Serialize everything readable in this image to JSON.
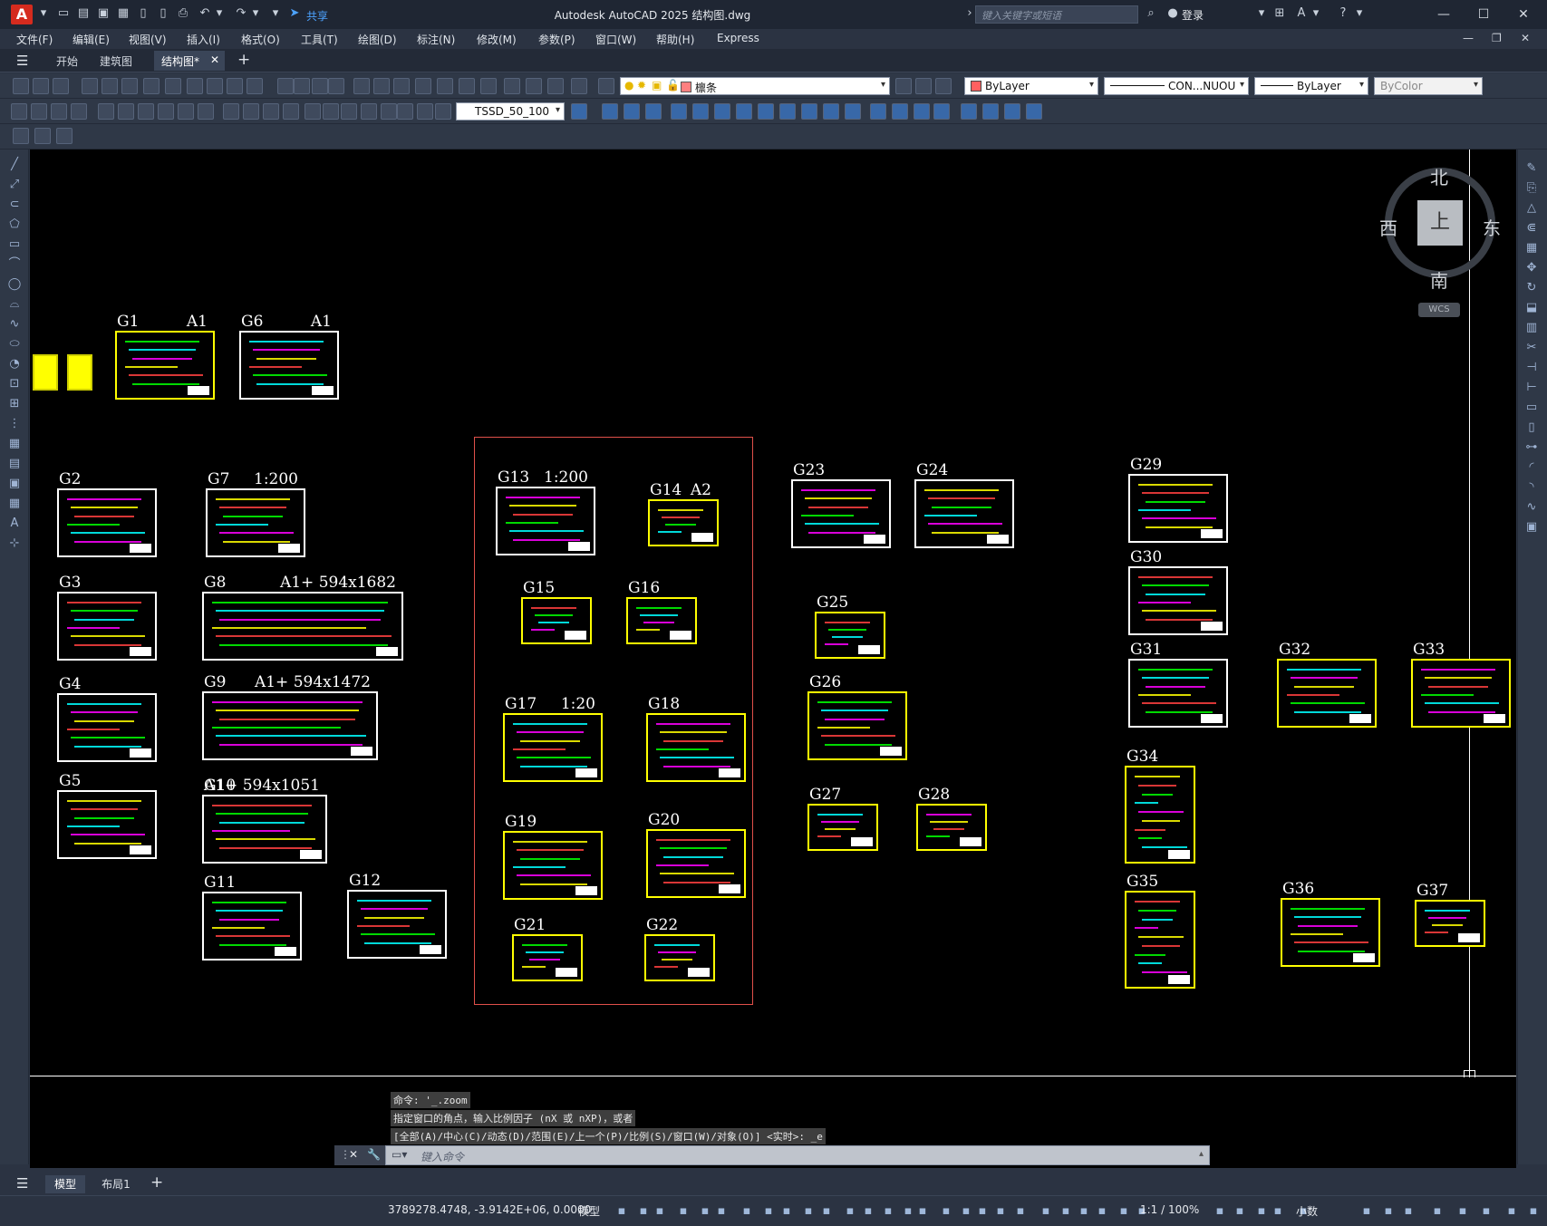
{
  "app": {
    "title": "Autodesk AutoCAD 2025    结构图.dwg",
    "share_label": "共享",
    "search_placeholder": "键入关键字或短语",
    "login_label": "登录"
  },
  "menu": [
    "文件(F)",
    "编辑(E)",
    "视图(V)",
    "插入(I)",
    "格式(O)",
    "工具(T)",
    "绘图(D)",
    "标注(N)",
    "修改(M)",
    "参数(P)",
    "窗口(W)",
    "帮助(H)",
    "Express"
  ],
  "tabs": [
    {
      "label": "开始",
      "active": false
    },
    {
      "label": "建筑图",
      "active": false
    },
    {
      "label": "结构图*",
      "active": true
    }
  ],
  "toolbar": {
    "layer_name": "檩条",
    "color_value": "ByLayer",
    "linetype_value": "CON...NUOU",
    "lineweight_value": "ByLayer",
    "plotstyle_value": "ByColor",
    "dimstyle_value": "TSSD_50_100"
  },
  "viewcube": {
    "north": "北",
    "south": "南",
    "east": "东",
    "west": "西",
    "face": "上",
    "wcs": "WCS"
  },
  "drawing": {
    "sheets": [
      {
        "id": "G1",
        "label": "G1",
        "scale": "A1"
      },
      {
        "id": "G6",
        "label": "G6",
        "scale": "A1"
      },
      {
        "id": "G2",
        "label": "G2",
        "scale": ""
      },
      {
        "id": "G7",
        "label": "G7",
        "scale": "1:200"
      },
      {
        "id": "G3",
        "label": "G3",
        "scale": ""
      },
      {
        "id": "G8",
        "label": "G8",
        "scale": "A1+ 594x1682"
      },
      {
        "id": "G4",
        "label": "G4",
        "scale": ""
      },
      {
        "id": "G9",
        "label": "G9",
        "scale": "A1+ 594x1472"
      },
      {
        "id": "G5",
        "label": "G5",
        "scale": ""
      },
      {
        "id": "G10",
        "label": "G10",
        "scale": "A1+ 594x1051"
      },
      {
        "id": "G11",
        "label": "G11",
        "scale": ""
      },
      {
        "id": "G12",
        "label": "G12",
        "scale": ""
      },
      {
        "id": "G13",
        "label": "G13",
        "scale": "1:200"
      },
      {
        "id": "G14",
        "label": "G14",
        "scale": "A2"
      },
      {
        "id": "G15",
        "label": "G15",
        "scale": ""
      },
      {
        "id": "G16",
        "label": "G16",
        "scale": ""
      },
      {
        "id": "G17",
        "label": "G17",
        "scale": "1:20"
      },
      {
        "id": "G18",
        "label": "G18",
        "scale": ""
      },
      {
        "id": "G19",
        "label": "G19",
        "scale": ""
      },
      {
        "id": "G20",
        "label": "G20",
        "scale": ""
      },
      {
        "id": "G21",
        "label": "G21",
        "scale": ""
      },
      {
        "id": "G22",
        "label": "G22",
        "scale": ""
      },
      {
        "id": "G23",
        "label": "G23",
        "scale": ""
      },
      {
        "id": "G24",
        "label": "G24",
        "scale": ""
      },
      {
        "id": "G25",
        "label": "G25",
        "scale": ""
      },
      {
        "id": "G26",
        "label": "G26",
        "scale": ""
      },
      {
        "id": "G27",
        "label": "G27",
        "scale": ""
      },
      {
        "id": "G28",
        "label": "G28",
        "scale": ""
      },
      {
        "id": "G29",
        "label": "G29",
        "scale": ""
      },
      {
        "id": "G30",
        "label": "G30",
        "scale": ""
      },
      {
        "id": "G31",
        "label": "G31",
        "scale": ""
      },
      {
        "id": "G32",
        "label": "G32",
        "scale": ""
      },
      {
        "id": "G33",
        "label": "G33",
        "scale": ""
      },
      {
        "id": "G34",
        "label": "G34",
        "scale": ""
      },
      {
        "id": "G35",
        "label": "G35",
        "scale": ""
      },
      {
        "id": "G36",
        "label": "G36",
        "scale": ""
      },
      {
        "id": "G37",
        "label": "G37",
        "scale": ""
      }
    ]
  },
  "command": {
    "history": [
      "命令: '_.zoom",
      "指定窗口的角点，输入比例因子 (nX 或 nXP)，或者",
      "[全部(A)/中心(C)/动态(D)/范围(E)/上一个(P)/比例(S)/窗口(W)/对象(O)] <实时>: _e"
    ],
    "placeholder": "键入命令"
  },
  "layout_tabs": [
    {
      "label": "模型",
      "active": true
    },
    {
      "label": "布局1",
      "active": false
    }
  ],
  "status": {
    "coordinates": "3789278.4748, -3.9142E+06, 0.0000",
    "model_label": "模型",
    "annotation_scale": "1:1 / 100%",
    "units": "小数"
  }
}
